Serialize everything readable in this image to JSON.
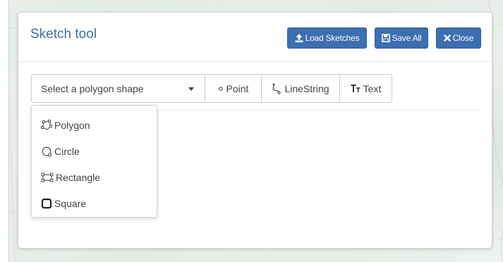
{
  "dialog": {
    "title": "Sketch tool",
    "buttons": {
      "load": "Load Sketches",
      "save": "Save All",
      "close": "Close"
    }
  },
  "toolbar": {
    "shape_select": "Select a polygon shape",
    "point": "Point",
    "linestring": "LineString",
    "text": "Text"
  },
  "shape_menu": {
    "items": [
      {
        "label": "Polygon",
        "icon": "polygon-icon"
      },
      {
        "label": "Circle",
        "icon": "circle-icon"
      },
      {
        "label": "Rectangle",
        "icon": "rectangle-icon"
      },
      {
        "label": "Square",
        "icon": "square-icon"
      }
    ]
  },
  "colors": {
    "primary_button": "#3d6eaf",
    "title": "#3e6fa5",
    "text": "#444444"
  }
}
